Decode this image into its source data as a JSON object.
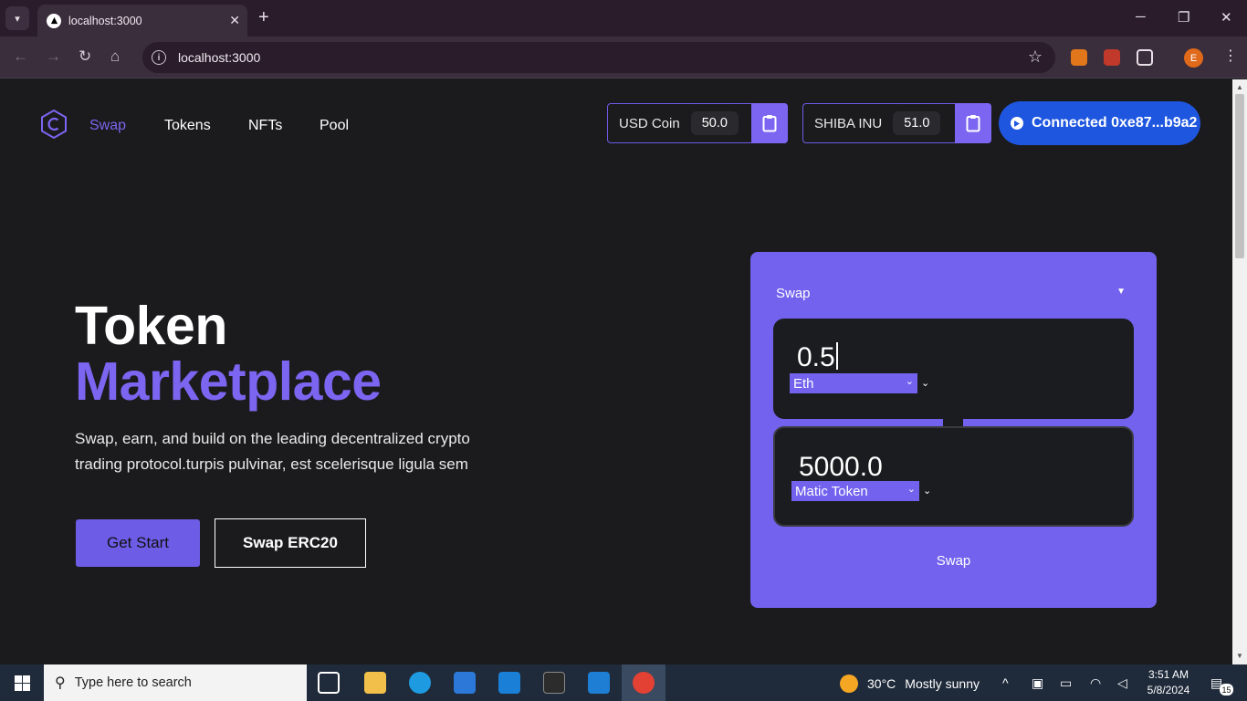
{
  "browser": {
    "tab_title": "localhost:3000",
    "url": "localhost:3000",
    "profile_initial": "E"
  },
  "nav": {
    "links": [
      "Swap",
      "Tokens",
      "NFTs",
      "Pool"
    ],
    "active": "Swap"
  },
  "tokens": [
    {
      "name": "USD Coin",
      "balance": "50.0"
    },
    {
      "name": "SHIBA INU",
      "balance": "51.0"
    }
  ],
  "wallet": {
    "label": "Connected 0xe87...b9a2"
  },
  "hero": {
    "title_line1": "Token",
    "title_line2": "Marketplace",
    "description": "Swap, earn, and build on the leading decentralized crypto trading protocol.turpis pulvinar, est scelerisque ligula sem",
    "primary_button": "Get Start",
    "secondary_button": "Swap ERC20"
  },
  "swap": {
    "header": "Swap",
    "from_amount": "0.5",
    "from_token": "Eth",
    "to_amount": "5000.0",
    "to_token": "Matic Token",
    "submit": "Swap"
  },
  "taskbar": {
    "search_placeholder": "Type here to search",
    "weather_temp": "30°C",
    "weather_desc": "Mostly sunny",
    "time": "3:51 AM",
    "date": "5/8/2024",
    "notification_count": "15"
  },
  "colors": {
    "accent": "#7262ee",
    "connect": "#1f56e0",
    "background": "#1b1b1d"
  }
}
